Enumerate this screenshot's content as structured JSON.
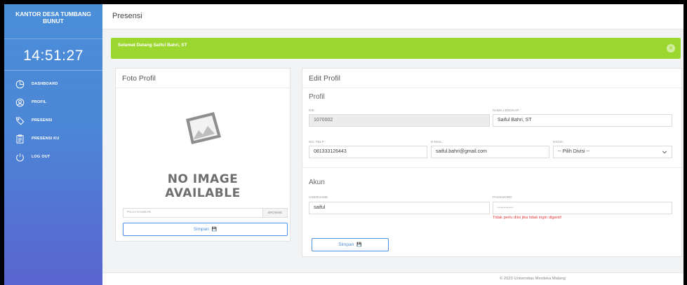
{
  "sidebar": {
    "brand_line1": "KANTOR DESA TUMBANG",
    "brand_line2": "BUNUT",
    "clock": "14:51:27",
    "items": [
      {
        "label": "DASHBOARD",
        "icon": "pie-chart-icon"
      },
      {
        "label": "PROFIL",
        "icon": "user-icon"
      },
      {
        "label": "PRESENSI",
        "icon": "tag-icon"
      },
      {
        "label": "PRESENSI KU",
        "icon": "clipboard-icon"
      },
      {
        "label": "LOG OUT",
        "icon": "power-icon"
      }
    ]
  },
  "topbar": {
    "title": "Presensi"
  },
  "alert": {
    "message": "Selamat Datang Saiful Bahri, ST",
    "color": "#9bd72e"
  },
  "photo_card": {
    "title": "Foto Profil",
    "no_image_line1": "NO IMAGE",
    "no_image_line2": "AVAILABLE",
    "file_placeholder": "PILIH GAMBAR",
    "browse_label": "BROWSE",
    "save_label": "Simpan"
  },
  "edit_card": {
    "title": "Edit Profil",
    "profil_heading": "Profil",
    "nik_label": "NIK :",
    "nik_value": "1070002",
    "nama_label": "NAMA LENGKAP :",
    "nama_value": "Saiful Bahri, ST",
    "telp_label": "NO. TELP :",
    "telp_value": "081333126443",
    "email_label": "E-MAIL :",
    "email_value": "saiful.bahri@gmail.com",
    "divisi_label": "DIVISI :",
    "divisi_value": "-- Pilih Divisi --",
    "akun_heading": "Akun",
    "username_label": "USERNAME",
    "username_value": "saiful",
    "password_label": "PASSWORD",
    "password_value": "••••••••••",
    "password_hint": "Tidak perlu diisi jika tidak ingin diganti!",
    "save_label": "Simpan"
  },
  "footer": {
    "text": "© 2023 Universitas Merdeka Malang"
  },
  "colors": {
    "accent": "#4d8fe0",
    "sidebar_top": "#4a8ed8",
    "sidebar_bottom": "#5a64d0",
    "error": "#e23a3a"
  }
}
